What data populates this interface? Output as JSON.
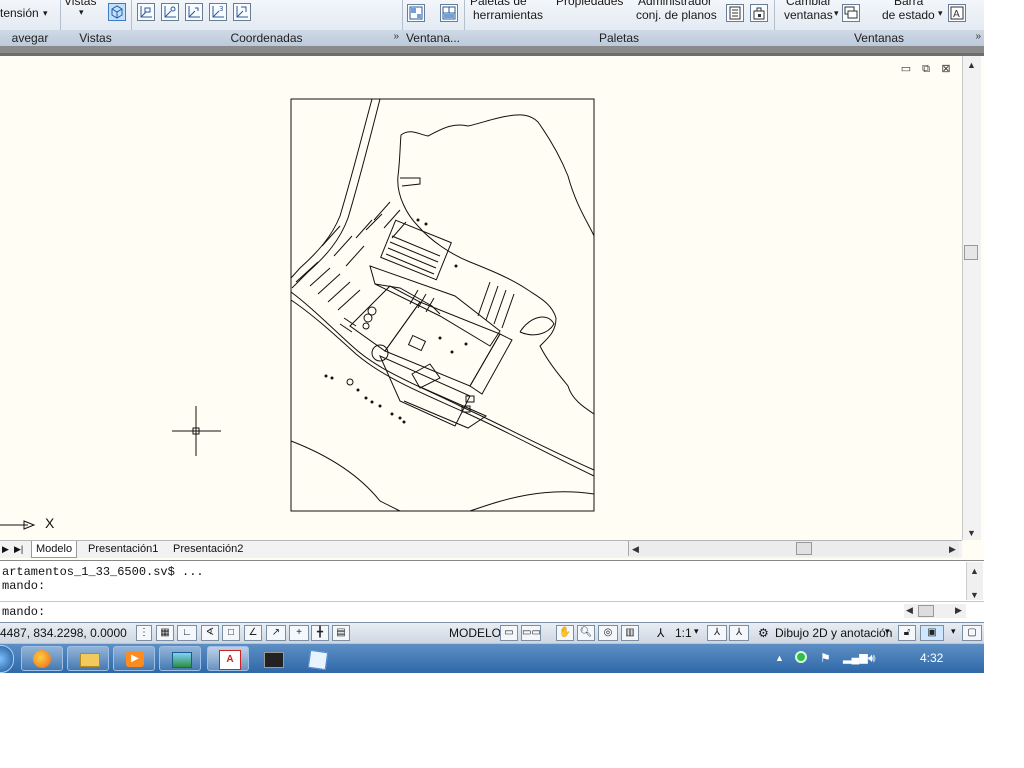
{
  "ribbon": {
    "panels": [
      {
        "title": "avegar",
        "items": [
          "tensión"
        ]
      },
      {
        "title": "Vistas",
        "items": [
          "Vistas"
        ]
      },
      {
        "title": "Coordenadas",
        "items": []
      },
      {
        "title": "Ventana...",
        "items": []
      },
      {
        "title": "Paletas",
        "items": [
          "Paletas de herramientas",
          "Propiedades",
          "Administrador conj. de planos"
        ]
      },
      {
        "title": "Ventanas",
        "items": [
          "Cambiar ventanas",
          "Barra de estado"
        ]
      }
    ],
    "extension_label": "tensión",
    "vistas_label": "Vistas",
    "paletas_herr_1": "Paletas de",
    "paletas_herr_2": "herramientas",
    "propiedades": "Propiedades",
    "admin_1": "Administrador",
    "admin_2": "conj. de planos",
    "cambiar_1": "Cambiar",
    "cambiar_2": "ventanas",
    "barra_1": "Barra",
    "barra_2": "de estado",
    "launcher_glyph": "»"
  },
  "drawing": {
    "axis_label": "X",
    "tabs": [
      "Modelo",
      "Presentación1",
      "Presentación2"
    ],
    "nav_first": "|◀",
    "nav_prev": "◀",
    "nav_next": "▶",
    "nav_last": "▶|"
  },
  "command": {
    "line1": "artamentos_1_33_6500.sv$ ...",
    "line2": "mando:",
    "prompt": "mando:"
  },
  "status": {
    "coords": "4487, 834.2298, 0.0000",
    "model": "MODELO",
    "scale": "1:1",
    "workspace": "Dibujo 2D y anotación"
  },
  "taskbar": {
    "clock": "4:32",
    "apps": [
      "start-orb",
      "firefox",
      "explorer",
      "media-player",
      "photo-gallery",
      "autocad",
      "app-6",
      "app-7"
    ]
  },
  "colors": {
    "canvas": "#fffdf4",
    "ribbon": "#dbe4ee",
    "taskbar": "#2f68a8"
  }
}
